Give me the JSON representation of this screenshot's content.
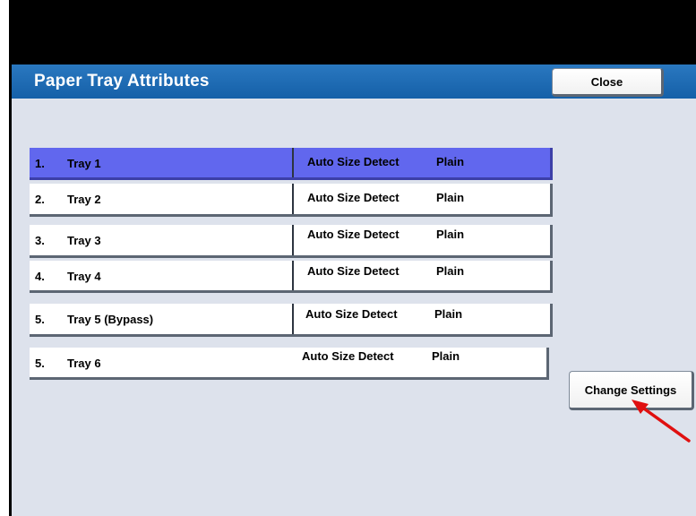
{
  "window": {
    "title": "Paper Tray Attributes",
    "close_label": "Close"
  },
  "trays": [
    {
      "number": "1.",
      "name": "Tray 1",
      "size": "Auto Size Detect",
      "type": "Plain",
      "selected": true
    },
    {
      "number": "2.",
      "name": "Tray 2",
      "size": "Auto Size Detect",
      "type": "Plain",
      "selected": false
    },
    {
      "number": "3.",
      "name": "Tray 3",
      "size": "Auto Size Detect",
      "type": "Plain",
      "selected": false
    },
    {
      "number": "4.",
      "name": "Tray 4",
      "size": "Auto Size Detect",
      "type": "Plain",
      "selected": false
    },
    {
      "number": "5.",
      "name": "Tray 5 (Bypass)",
      "size": "Auto Size Detect",
      "type": "Plain",
      "selected": false
    },
    {
      "number": "5.",
      "name": "Tray 6",
      "size": "Auto Size Detect",
      "type": "Plain",
      "selected": false
    }
  ],
  "actions": {
    "change_settings_label": "Change Settings"
  },
  "colors": {
    "title_bar": "#1a66b0",
    "panel_background": "#dde2ec",
    "selected_row": "#6167ee",
    "annotation_arrow": "#e01010"
  }
}
